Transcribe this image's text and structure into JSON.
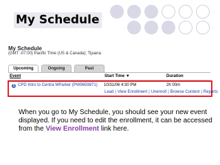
{
  "slide": {
    "title": "My Schedule",
    "decor_colors": [
      "#d8d8e6",
      "#c8c8dc",
      "#ffffff"
    ]
  },
  "app": {
    "title": "My Schedule",
    "timezone": "(GMT -07:00) Pacific Time (US & Canada); Tijuana",
    "tabs": [
      {
        "label": "Upcoming",
        "active": true
      },
      {
        "label": "Ongoing",
        "active": false
      },
      {
        "label": "Past",
        "active": false
      }
    ],
    "columns": {
      "event": "Event",
      "start_time": "Start Time ▼",
      "duration": "Duration"
    },
    "rows": [
      {
        "event": "CPD Intro to Centra MParker (PW9659871)",
        "start_time": "10/31/06 4:30 PM",
        "duration": "2h 00m",
        "actions": [
          "Lead",
          "View Enrollment",
          "Unenroll",
          "Browse Content",
          "Reports"
        ]
      }
    ],
    "highlight_color": "#e3202a"
  },
  "caption": {
    "text_before": "When you go to My Schedule, you should see your new event displayed. If you need to edit the enrollment, it can be accessed from the ",
    "link_text": "View Enrollment",
    "text_after": " link here."
  }
}
